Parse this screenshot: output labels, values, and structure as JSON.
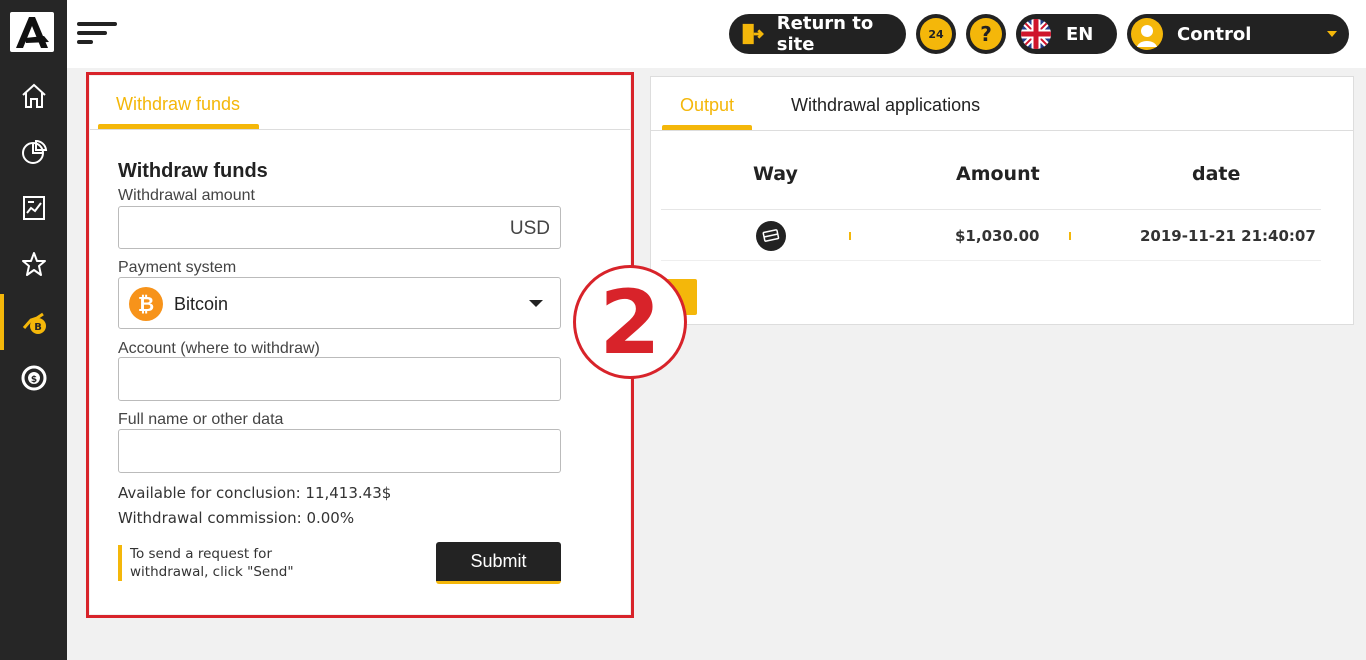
{
  "header": {
    "return_label": "Return to site",
    "support_badge": "24",
    "help_icon": "?",
    "language": "EN",
    "user_label": "Control"
  },
  "sidebar": {
    "items": [
      "home-icon",
      "pie-chart-icon",
      "report-icon",
      "star-icon",
      "withdraw-coin-icon",
      "exchange-icon"
    ],
    "active": "withdraw-coin-icon"
  },
  "withdraw": {
    "tab_label": "Withdraw funds",
    "title": "Withdraw funds",
    "amount_label": "Withdrawal amount",
    "amount_value": "",
    "currency": "USD",
    "payment_label": "Payment system",
    "payment_value": "Bitcoin",
    "account_label": "Account (where to withdraw)",
    "account_value": "",
    "fullname_label": "Full name or other data",
    "fullname_value": "",
    "available": "Available for conclusion: 11,413.43$",
    "commission": "Withdrawal commission: 0.00%",
    "hint": "To send a request for withdrawal, click \"Send\"",
    "submit_label": "Submit"
  },
  "step": "2",
  "output": {
    "tabs": [
      "Output",
      "Withdrawal applications"
    ],
    "columns": [
      "Way",
      "Amount",
      "date"
    ],
    "rows": [
      {
        "way": "card-icon",
        "amount": "$1,030.00",
        "date": "2019-11-21 21:40:07"
      }
    ]
  },
  "colors": {
    "accent": "#f4b70a",
    "sidebar": "#262626",
    "highlight": "#d8232a",
    "bitcoin": "#f7931a"
  }
}
